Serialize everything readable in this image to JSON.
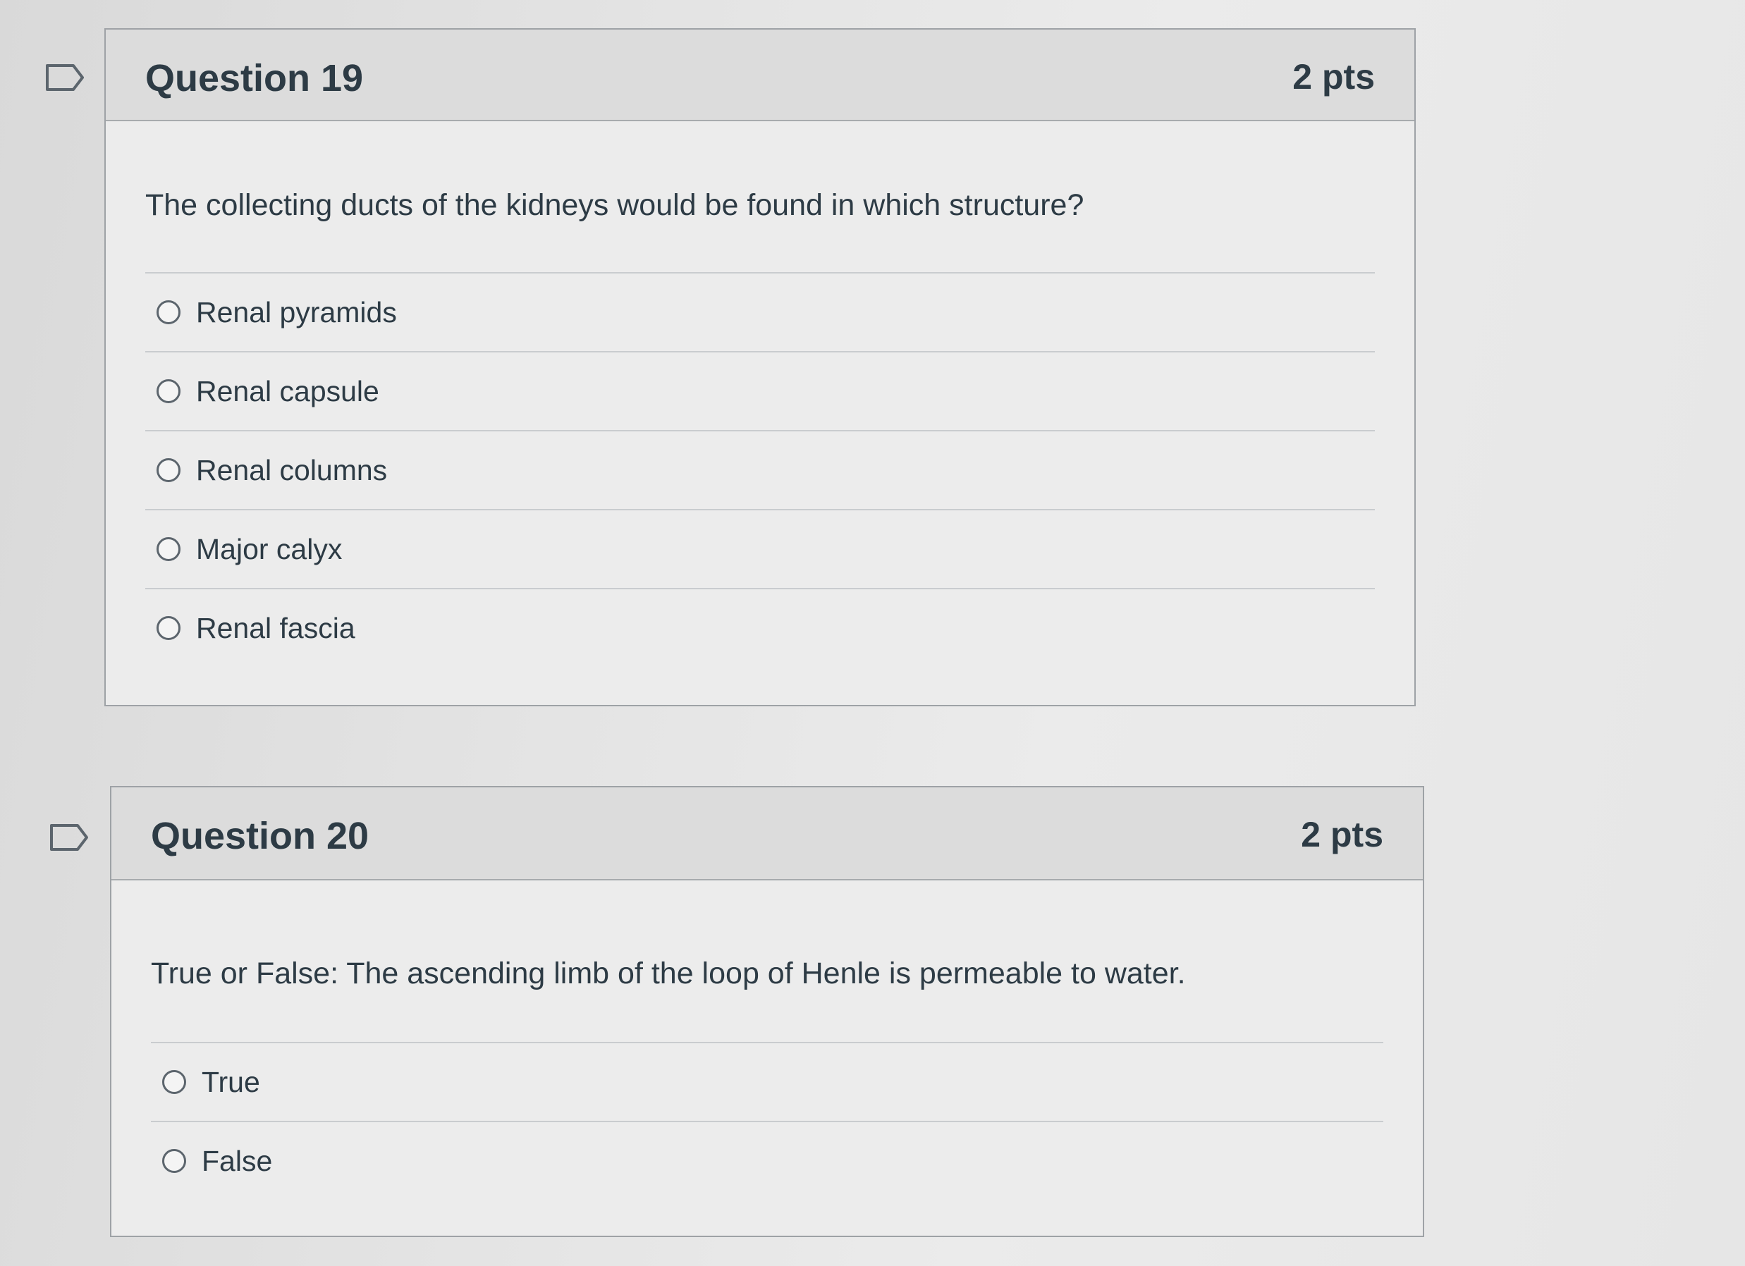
{
  "questions": [
    {
      "title": "Question 19",
      "points": "2 pts",
      "text": "The collecting ducts of the kidneys would be found in which structure?",
      "answers": [
        "Renal pyramids",
        "Renal capsule",
        "Renal columns",
        "Major calyx",
        "Renal fascia"
      ]
    },
    {
      "title": "Question 20",
      "points": "2 pts",
      "text": "True or False: The ascending limb of the loop of Henle is permeable to water.",
      "answers": [
        "True",
        "False"
      ]
    }
  ],
  "icons": {
    "flag": "flag-outline-icon",
    "radio": "radio-unselected-icon"
  },
  "colors": {
    "text": "#2d3b45",
    "header_bg": "#dcdcdc",
    "border": "#9ea2a6"
  }
}
